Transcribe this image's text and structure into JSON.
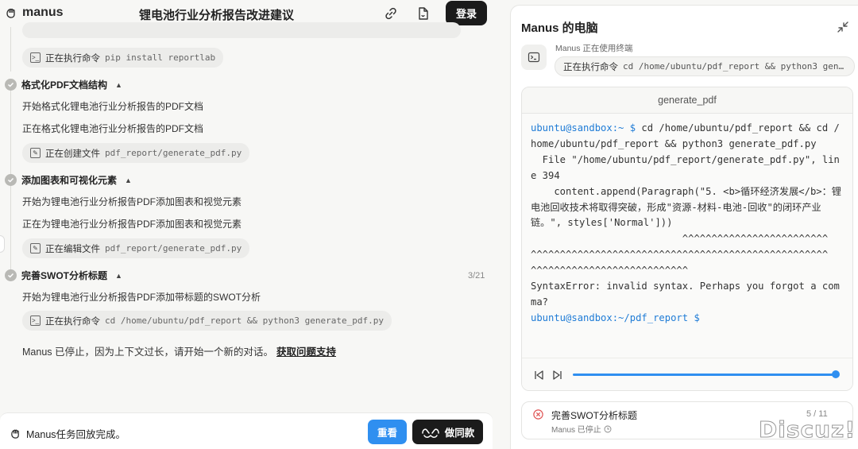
{
  "app": {
    "logo": "manus",
    "title": "锂电池行业分析报告改进建议",
    "login_label": "登录"
  },
  "tasks": [
    {
      "command_label": "正在执行命令",
      "command_arg": "pip install reportlab"
    },
    {
      "title": "格式化PDF文档结构",
      "lines": [
        "开始格式化锂电池行业分析报告的PDF文档",
        "正在格式化锂电池行业分析报告的PDF文档"
      ],
      "tool_label": "正在创建文件",
      "tool_arg": "pdf_report/generate_pdf.py"
    },
    {
      "title": "添加图表和可视化元素",
      "lines": [
        "开始为锂电池行业分析报告PDF添加图表和视觉元素",
        "正在为锂电池行业分析报告PDF添加图表和视觉元素"
      ],
      "tool_label": "正在编辑文件",
      "tool_arg": "pdf_report/generate_pdf.py"
    },
    {
      "title": "完善SWOT分析标题",
      "count": "3/21",
      "lines": [
        "开始为锂电池行业分析报告PDF添加带标题的SWOT分析"
      ],
      "tool_label": "正在执行命令",
      "tool_arg": "cd /home/ubuntu/pdf_report && python3 generate_pdf.py"
    }
  ],
  "stop_message": "Manus 已停止，因为上下文过长，请开始一个新的对话。",
  "stop_link": "获取问题支持",
  "bottom": {
    "status": "Manus任务回放完成。",
    "replay_label": "重看",
    "same_label": "做同款"
  },
  "computer": {
    "title": "Manus 的电脑",
    "using_label": "Manus 正在使用终端",
    "command_label": "正在执行命令",
    "command_arg": "cd /home/ubuntu/pdf_report && python3 gene…",
    "tab_title": "generate_pdf",
    "terminal_lines": [
      {
        "prompt": "ubuntu@sandbox:~ $",
        "text": " cd /home/ubuntu/pdf_report && cd /"
      },
      {
        "prompt": "",
        "text": "home/ubuntu/pdf_report && python3 generate_pdf.py"
      },
      {
        "prompt": "",
        "text": "  File \"/home/ubuntu/pdf_report/generate_pdf.py\", lin"
      },
      {
        "prompt": "",
        "text": "e 394"
      },
      {
        "prompt": "",
        "text": "    content.append(Paragraph(\"5. <b>循环经济发展</b>：锂"
      },
      {
        "prompt": "",
        "text": "电池回收技术将取得突破，形成\"资源-材料-电池-回收\"的闭环产业"
      },
      {
        "prompt": "",
        "text": "链。\", styles['Normal']))"
      },
      {
        "prompt": "",
        "text": "                          ^^^^^^^^^^^^^^^^^^^^^^^^^"
      },
      {
        "prompt": "",
        "text": "^^^^^^^^^^^^^^^^^^^^^^^^^^^^^^^^^^^^^^^^^^^^^^^^^^^"
      },
      {
        "prompt": "",
        "text": "^^^^^^^^^^^^^^^^^^^^^^^^^^^"
      },
      {
        "prompt": "",
        "text": "SyntaxError: invalid syntax. Perhaps you forgot a com"
      },
      {
        "prompt": "",
        "text": "ma?"
      },
      {
        "prompt": "ubuntu@sandbox:~/pdf_report $",
        "text": ""
      }
    ],
    "playback_progress": 1.0,
    "status_title": "完善SWOT分析标题",
    "status_sub": "Manus 已停止",
    "status_count": "5 / 11"
  },
  "watermark": "Discuz!",
  "colors": {
    "accent": "#2f8ff0",
    "prompt": "#1e7bd6",
    "dark_button": "#1b1b1b",
    "error": "#e05555"
  }
}
